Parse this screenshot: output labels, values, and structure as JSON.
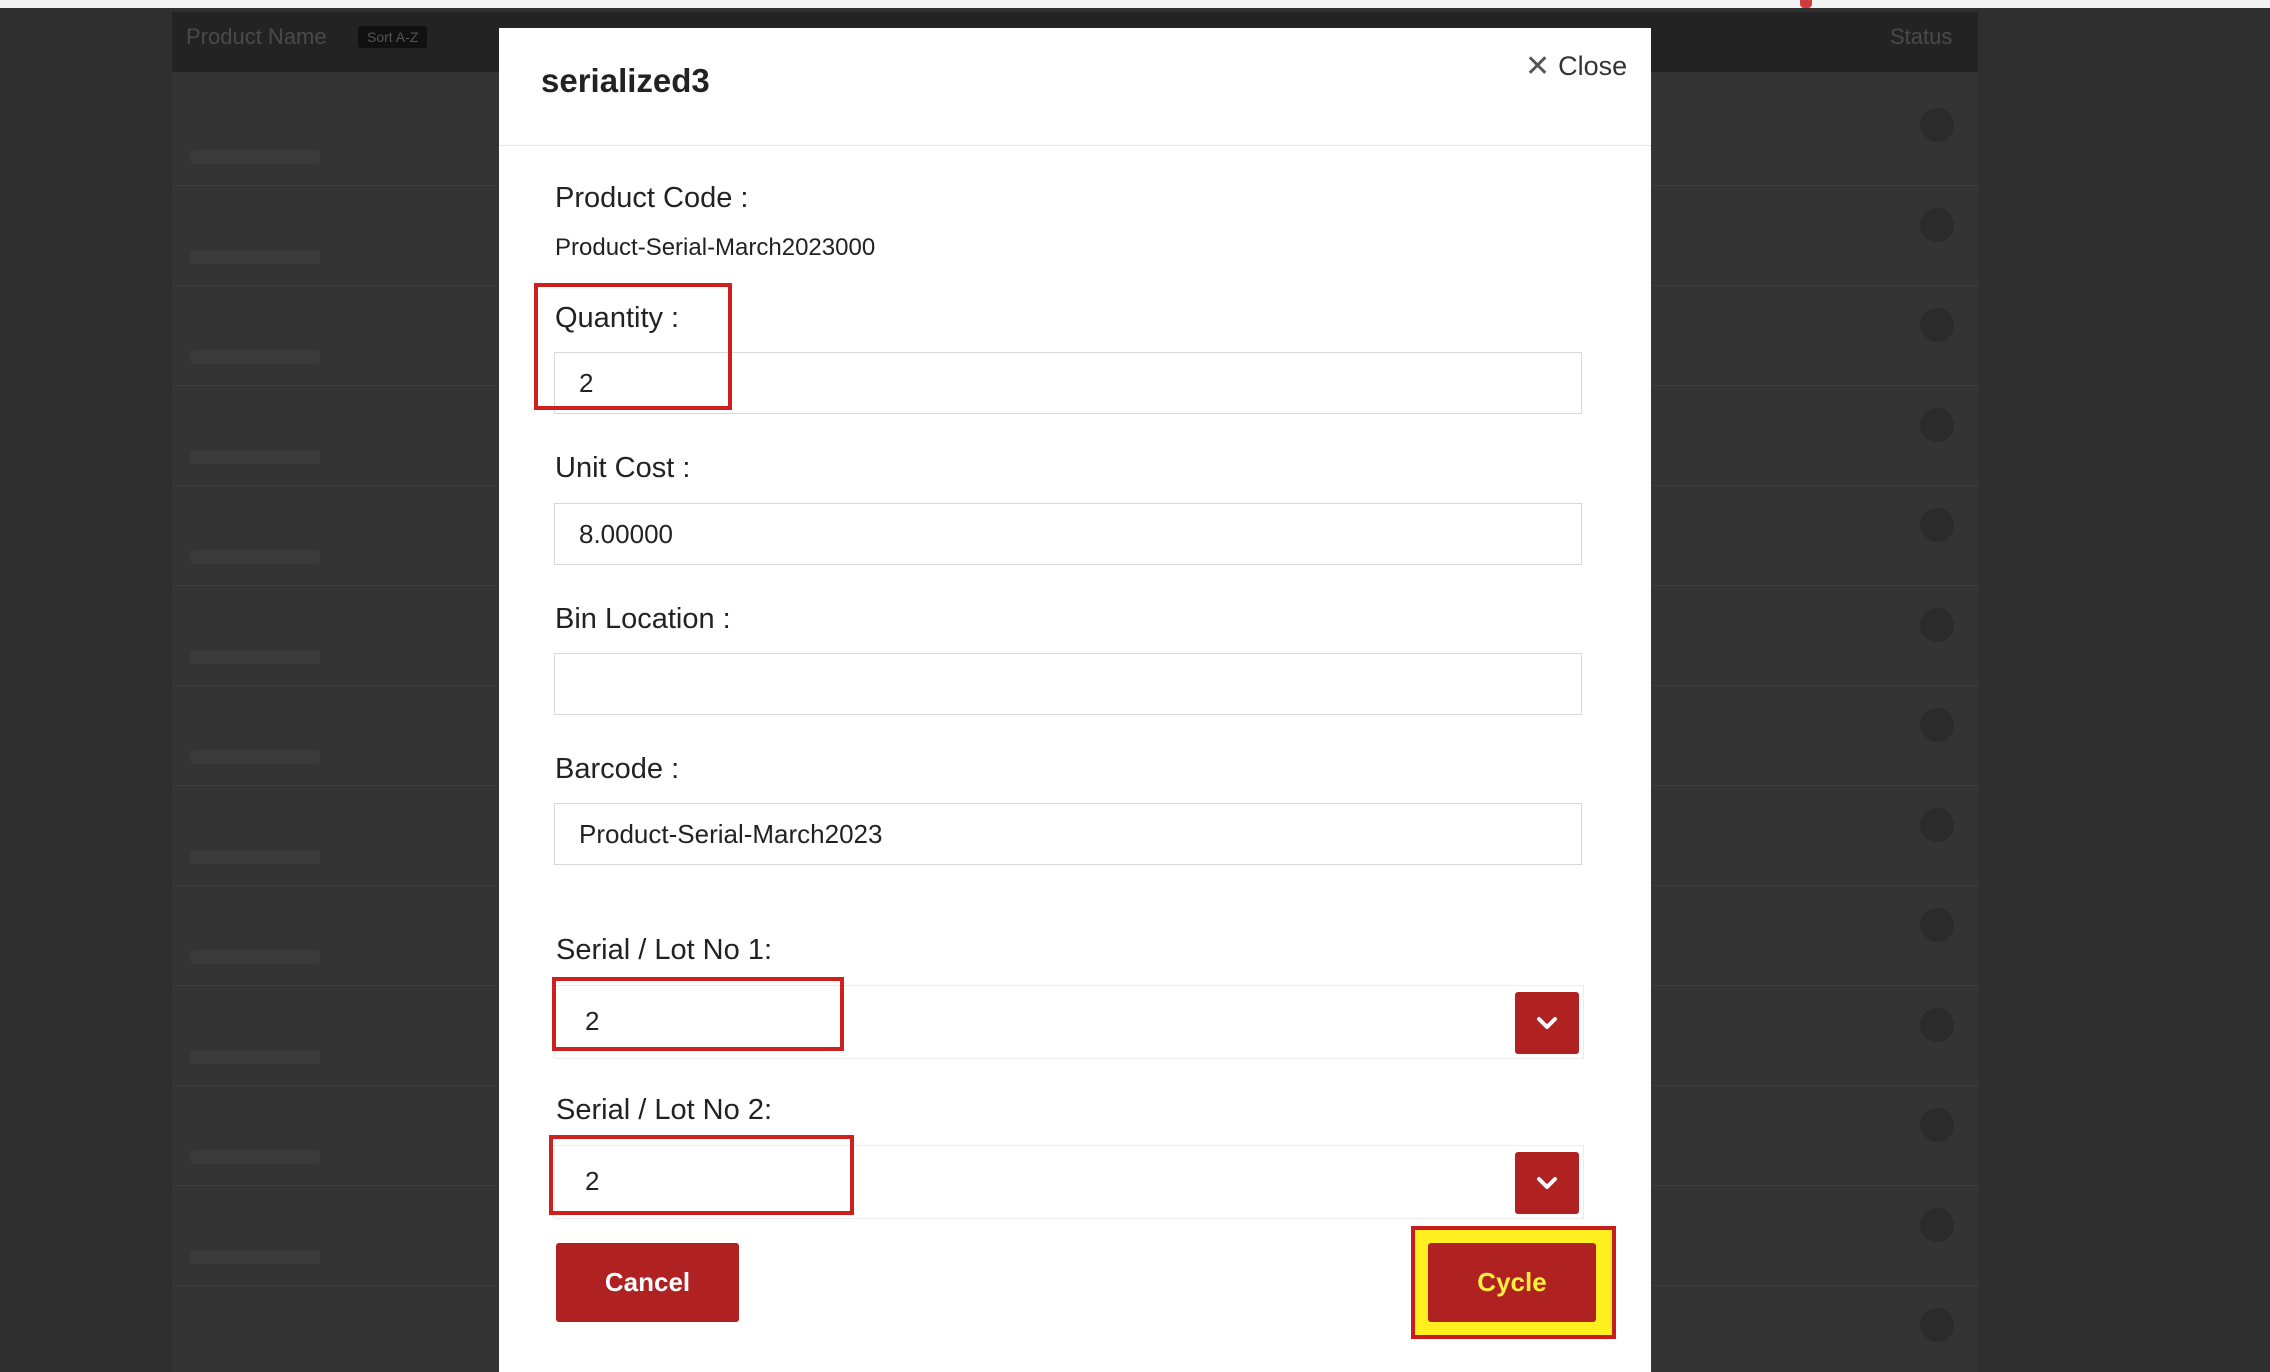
{
  "background": {
    "table_header": {
      "title": "Product Name",
      "sort_badge": "Sort A-Z",
      "status_label": "Status"
    }
  },
  "modal": {
    "title": "serialized3",
    "close_label": "Close",
    "product_code": {
      "label": "Product Code :",
      "value": "Product-Serial-March2023000"
    },
    "quantity": {
      "label": "Quantity :",
      "value": "2"
    },
    "unit_cost": {
      "label": "Unit Cost :",
      "value": "8.00000"
    },
    "bin_location": {
      "label": "Bin Location :",
      "value": ""
    },
    "barcode": {
      "label": "Barcode :",
      "value": "Product-Serial-March2023"
    },
    "serials": [
      {
        "label": "Serial / Lot No 1:",
        "value": "2"
      },
      {
        "label": "Serial / Lot No 2:",
        "value": "2"
      }
    ],
    "buttons": {
      "cancel": "Cancel",
      "cycle": "Cycle"
    }
  },
  "colors": {
    "accent_red": "#b02122",
    "highlight_red": "#cf2020",
    "highlight_yellow": "#ffef1f",
    "overlay": "#2f2f2f"
  }
}
